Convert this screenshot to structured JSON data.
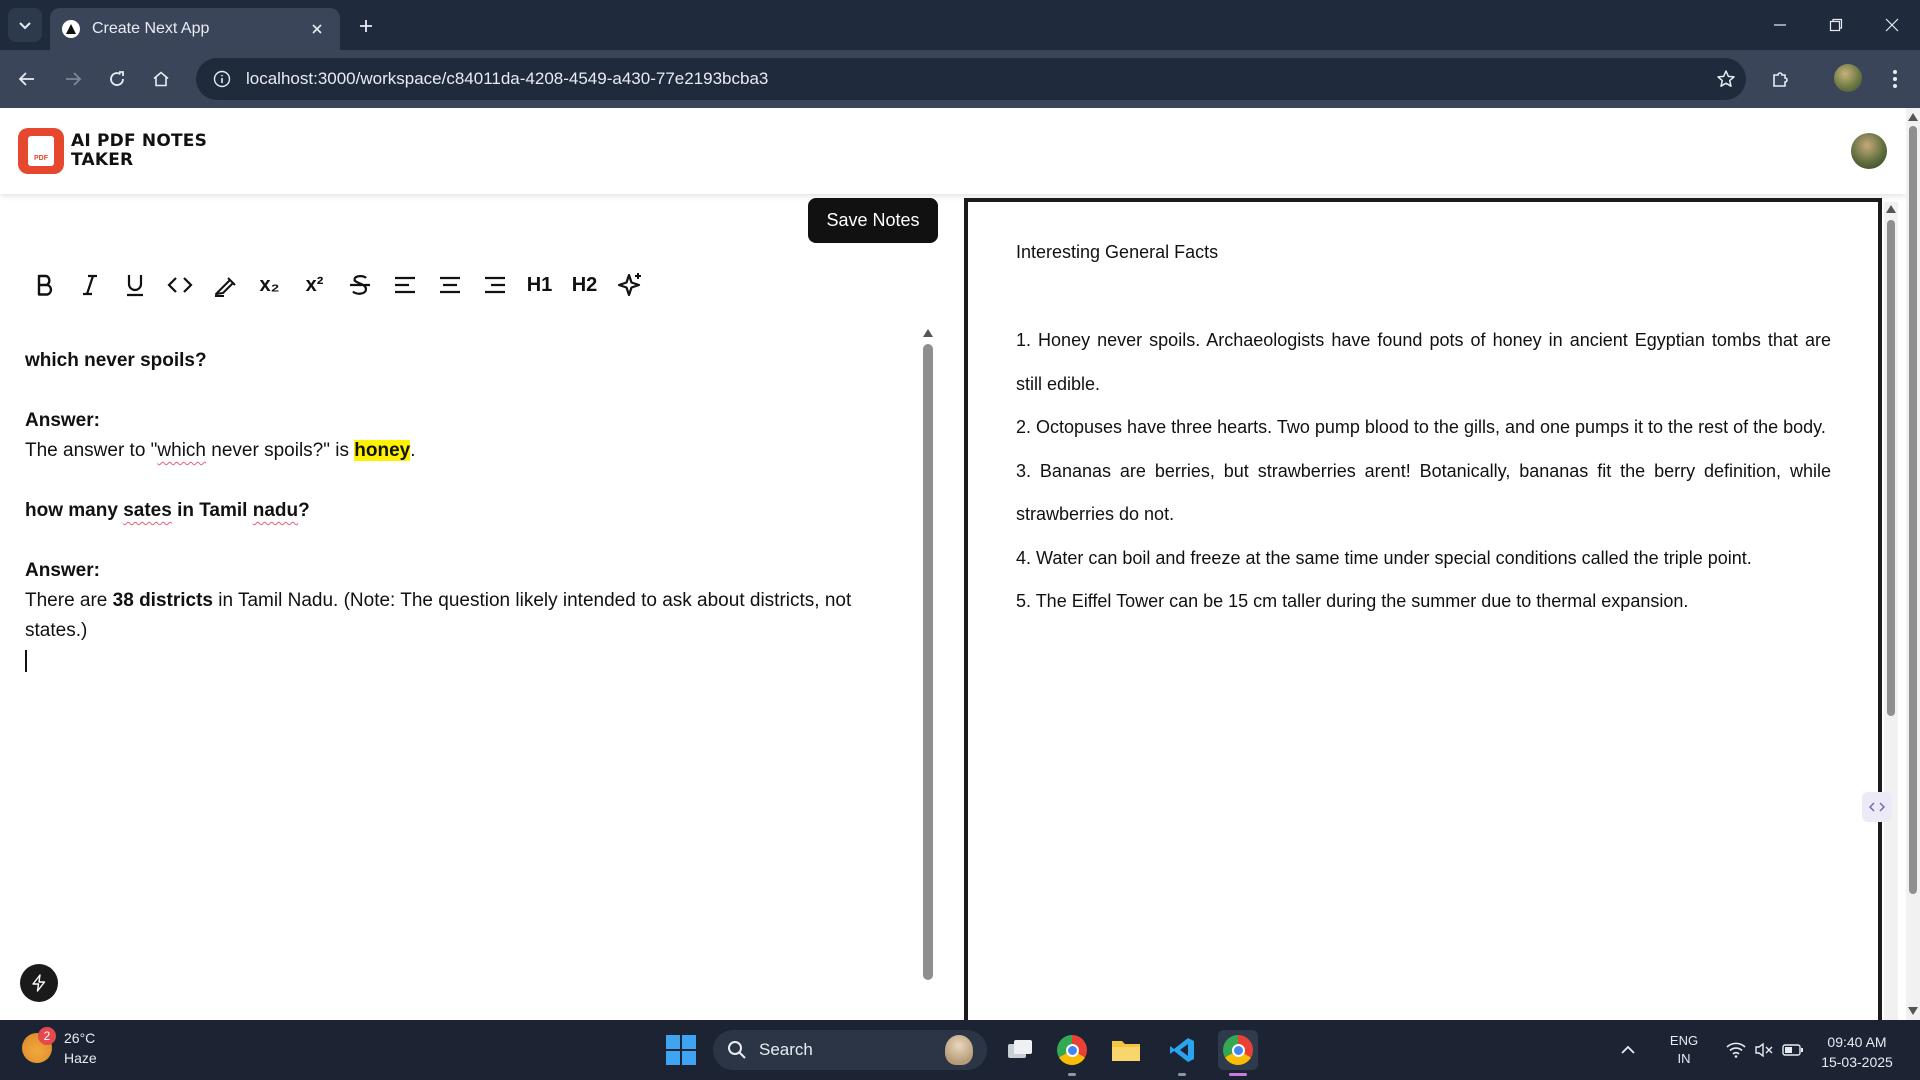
{
  "browser": {
    "tab_title": "Create Next App",
    "url": "localhost:3000/workspace/c84011da-4208-4549-a430-77e2193bcba3"
  },
  "app": {
    "logo_line1": "AI PDF NOTES",
    "logo_line2": "TAKER",
    "logo_badge": "PDF"
  },
  "editor": {
    "save_label": "Save Notes",
    "toolbar": {
      "subscript_label": "x₂",
      "superscript_label": "x²",
      "h1_label": "H1",
      "h2_label": "H2"
    },
    "q1": "which never spoils?",
    "answer_label": "Answer:",
    "a1_prefix": "The answer to \"",
    "a1_word1": "which",
    "a1_middle": " never spoils?\" is ",
    "a1_highlight": "honey",
    "a1_suffix": ".",
    "q2_prefix": "how many ",
    "q2_word_sates": "sates",
    "q2_middle": " in Tamil ",
    "q2_word_nadu": "nadu",
    "q2_suffix": "?",
    "a2_prefix": "There are ",
    "a2_bold": "38 districts",
    "a2_suffix": " in Tamil Nadu. (Note: The question likely intended to ask about districts, not states.)"
  },
  "pdf": {
    "title": "Interesting General Facts",
    "items": [
      "1. Honey never spoils. Archaeologists have found pots of honey in ancient Egyptian tombs that are still edible.",
      "2. Octopuses have three hearts. Two pump blood to the gills, and one pumps it to the rest of the body.",
      "3. Bananas are berries, but strawberries arent! Botanically, bananas fit the berry definition, while strawberries do not.",
      "4. Water can boil and freeze at the same time under special conditions called the triple point.",
      "5. The Eiffel Tower can be 15 cm taller during the summer due to thermal expansion."
    ]
  },
  "taskbar": {
    "weather_temp": "26°C",
    "weather_desc": "Haze",
    "weather_badge": "2",
    "search_label": "Search",
    "lang_line1": "ENG",
    "lang_line2": "IN",
    "time": "09:40 AM",
    "date": "15-03-2025"
  },
  "icons": {
    "accent": "#fff200",
    "logo_color": "#e5482f"
  }
}
